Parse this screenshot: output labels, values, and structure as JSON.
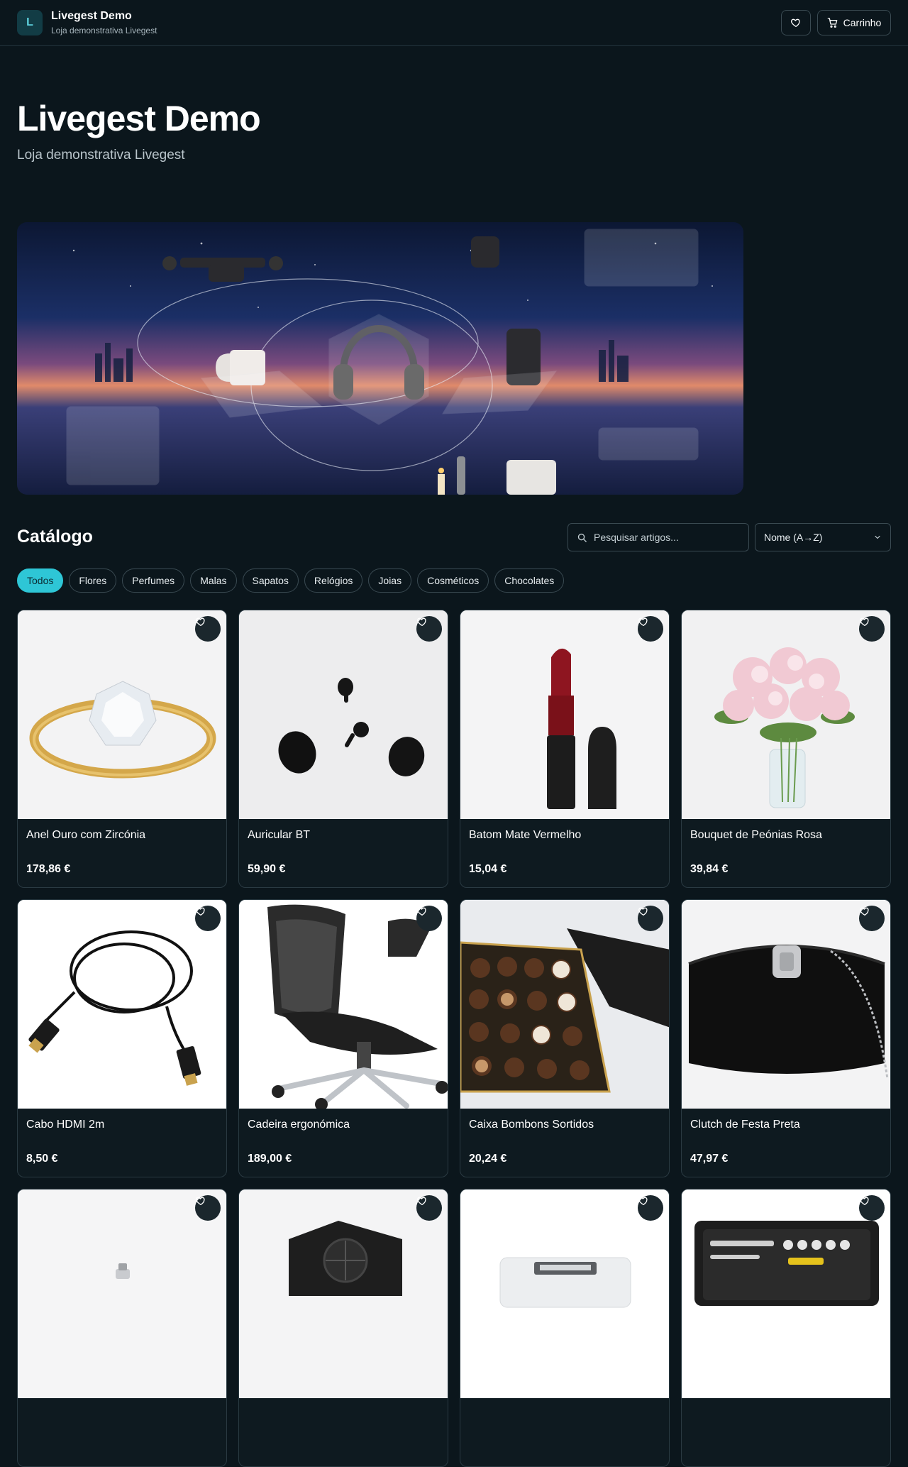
{
  "header": {
    "logo_letter": "L",
    "store_name": "Livegest Demo",
    "store_tagline": "Loja demonstrativa Livegest",
    "cart_label": "Carrinho",
    "favorites_icon": "heart-icon",
    "cart_icon": "cart-icon"
  },
  "hero": {
    "title": "Livegest Demo",
    "subtitle": "Loja demonstrativa Livegest"
  },
  "catalog": {
    "title": "Catálogo",
    "search_placeholder": "Pesquisar artigos...",
    "sort_selected": "Nome (A→Z)",
    "categories": [
      {
        "label": "Todos",
        "active": true
      },
      {
        "label": "Flores",
        "active": false
      },
      {
        "label": "Perfumes",
        "active": false
      },
      {
        "label": "Malas",
        "active": false
      },
      {
        "label": "Sapatos",
        "active": false
      },
      {
        "label": "Relógios",
        "active": false
      },
      {
        "label": "Joias",
        "active": false
      },
      {
        "label": "Cosméticos",
        "active": false
      },
      {
        "label": "Chocolates",
        "active": false
      }
    ],
    "products": [
      {
        "name": "Anel Ouro com Zircónia",
        "price": "178,86 €",
        "image": "gold-ring"
      },
      {
        "name": "Auricular BT",
        "price": "59,90 €",
        "image": "earbuds"
      },
      {
        "name": "Batom Mate Vermelho",
        "price": "15,04 €",
        "image": "lipstick"
      },
      {
        "name": "Bouquet de Peónias Rosa",
        "price": "39,84 €",
        "image": "peony-bouquet"
      },
      {
        "name": "Cabo HDMI 2m",
        "price": "8,50 €",
        "image": "hdmi-cable"
      },
      {
        "name": "Cadeira ergonómica",
        "price": "189,00 €",
        "image": "office-chair"
      },
      {
        "name": "Caixa Bombons Sortidos",
        "price": "20,24 €",
        "image": "chocolate-box"
      },
      {
        "name": "Clutch de Festa Preta",
        "price": "47,97 €",
        "image": "black-clutch"
      },
      {
        "name": "",
        "price": "",
        "image": "perfume-bottle"
      },
      {
        "name": "",
        "price": "",
        "image": "pc-power-supply"
      },
      {
        "name": "",
        "price": "",
        "image": "printer"
      },
      {
        "name": "",
        "price": "",
        "image": "tool-case"
      }
    ]
  },
  "colors": {
    "background": "#0b161c",
    "accent": "#2ec6d6",
    "card_border": "#2a3a42"
  }
}
